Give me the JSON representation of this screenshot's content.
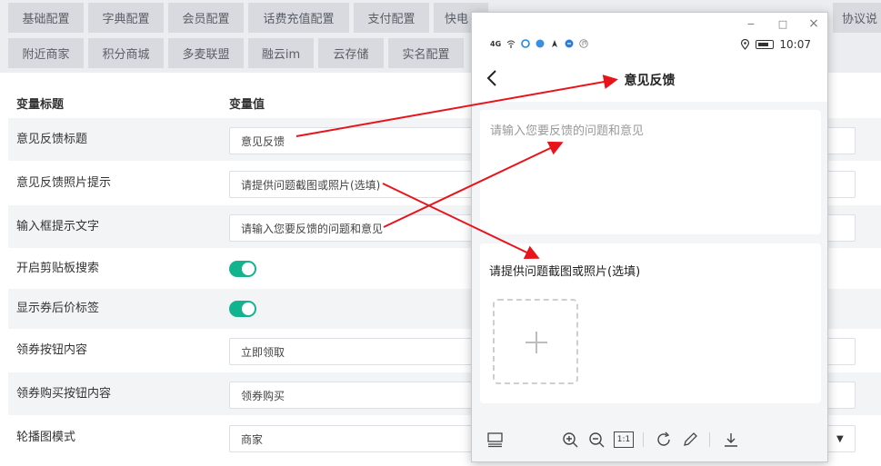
{
  "tabs": {
    "row1": [
      "基础配置",
      "字典配置",
      "会员配置",
      "话费充值配置",
      "支付配置",
      "快电",
      "",
      "",
      "",
      "",
      "协议说"
    ],
    "row2": [
      "附近商家",
      "积分商城",
      "多麦联盟",
      "融云im",
      "云存储",
      "实名配置"
    ]
  },
  "table": {
    "col_title": "变量标题",
    "col_value": "变量值"
  },
  "rows": [
    {
      "label": "意见反馈标题",
      "value": "意见反馈"
    },
    {
      "label": "意见反馈照片提示",
      "value": "请提供问题截图或照片(选填)"
    },
    {
      "label": "输入框提示文字",
      "value": "请输入您要反馈的问题和意见"
    },
    {
      "label": "开启剪贴板搜索",
      "toggle": true
    },
    {
      "label": "显示券后价标签",
      "toggle": true
    },
    {
      "label": "领券按钮内容",
      "value": "立即领取"
    },
    {
      "label": "领券购买按钮内容",
      "value": "领券购买"
    },
    {
      "label": "轮播图模式",
      "value": "商家"
    }
  ],
  "window": {
    "minimize": "−",
    "maximize": "□",
    "close": "×"
  },
  "phone": {
    "signal": "4G",
    "time": "10:07",
    "title": "意见反馈",
    "placeholder": "请输入您要反馈的问题和意见",
    "photo_tip": "请提供问题截图或照片(选填)",
    "zoom_reset": "1:1"
  },
  "colors": {
    "accent": "#13b38f",
    "arrow": "#e8141b",
    "tab_bg": "#d8dadf"
  },
  "icons": [
    "back-arrow-icon",
    "plus-icon",
    "zoom-in-icon",
    "zoom-out-icon",
    "rotate-icon",
    "pencil-icon",
    "download-icon",
    "thumbnail-icon"
  ]
}
